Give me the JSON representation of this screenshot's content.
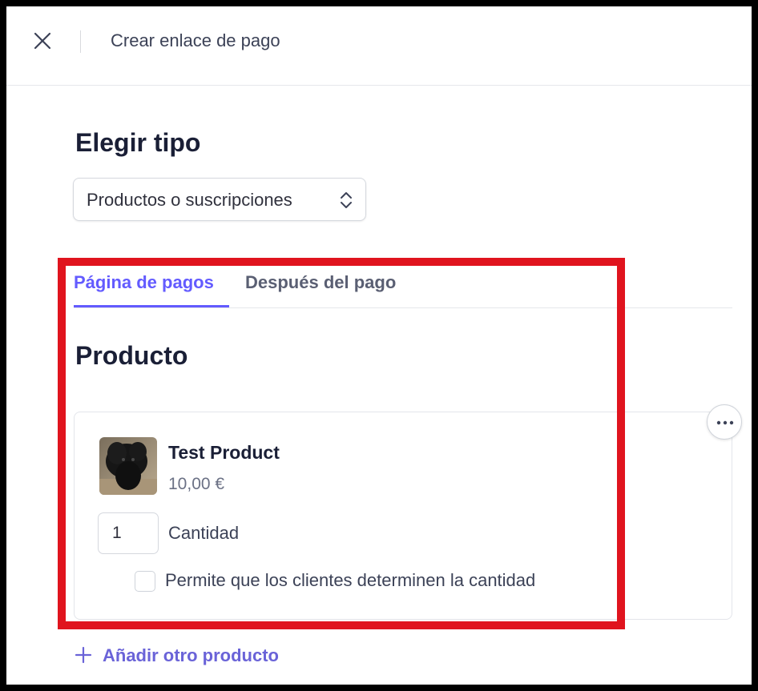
{
  "header": {
    "title": "Crear enlace de pago",
    "close_icon": "close-icon"
  },
  "type_section": {
    "title": "Elegir tipo",
    "selected_value": "Productos o suscripciones",
    "chevron_icon": "chevron-up-down-icon"
  },
  "tabs": [
    {
      "label": "Página de pagos",
      "active": true
    },
    {
      "label": "Después del pago",
      "active": false
    }
  ],
  "product_section": {
    "title": "Producto",
    "item": {
      "name": "Test Product",
      "price": "10,00 €",
      "quantity_value": "1",
      "quantity_label": "Cantidad",
      "allow_adjust_label": "Permite que los clientes determinen la cantidad",
      "allow_adjust_checked": false,
      "more_icon": "more-horizontal-icon",
      "image": "product-thumbnail"
    },
    "add_product_label": "Añadir otro producto",
    "add_icon": "plus-icon"
  },
  "colors": {
    "accent": "#635bff",
    "highlight": "#e0141e",
    "frame": "#000000"
  }
}
